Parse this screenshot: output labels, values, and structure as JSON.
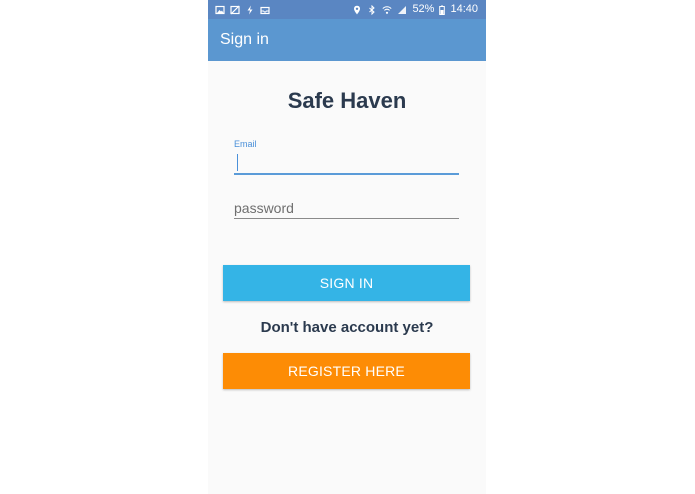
{
  "status_bar": {
    "battery": "52%",
    "time": "14:40",
    "icons_left": [
      "image-icon",
      "crossed-image-icon",
      "flash-icon",
      "tray-icon"
    ],
    "icons_right": [
      "location-pin-icon",
      "bluetooth-icon",
      "wifi-icon",
      "signal-icon",
      "battery-icon"
    ]
  },
  "app_bar": {
    "title": "Sign in"
  },
  "main": {
    "app_title": "Safe Haven",
    "email": {
      "label": "Email",
      "value": ""
    },
    "password": {
      "placeholder": "password"
    },
    "signin_button": "SIGN IN",
    "register_prompt": "Don't have account yet?",
    "register_button": "REGISTER HERE"
  },
  "colors": {
    "status_bar": "#5a86c2",
    "app_bar": "#5b97d0",
    "signin_button": "#34b4e6",
    "register_button": "#fd8c05",
    "title_text": "#2b3a4e"
  }
}
